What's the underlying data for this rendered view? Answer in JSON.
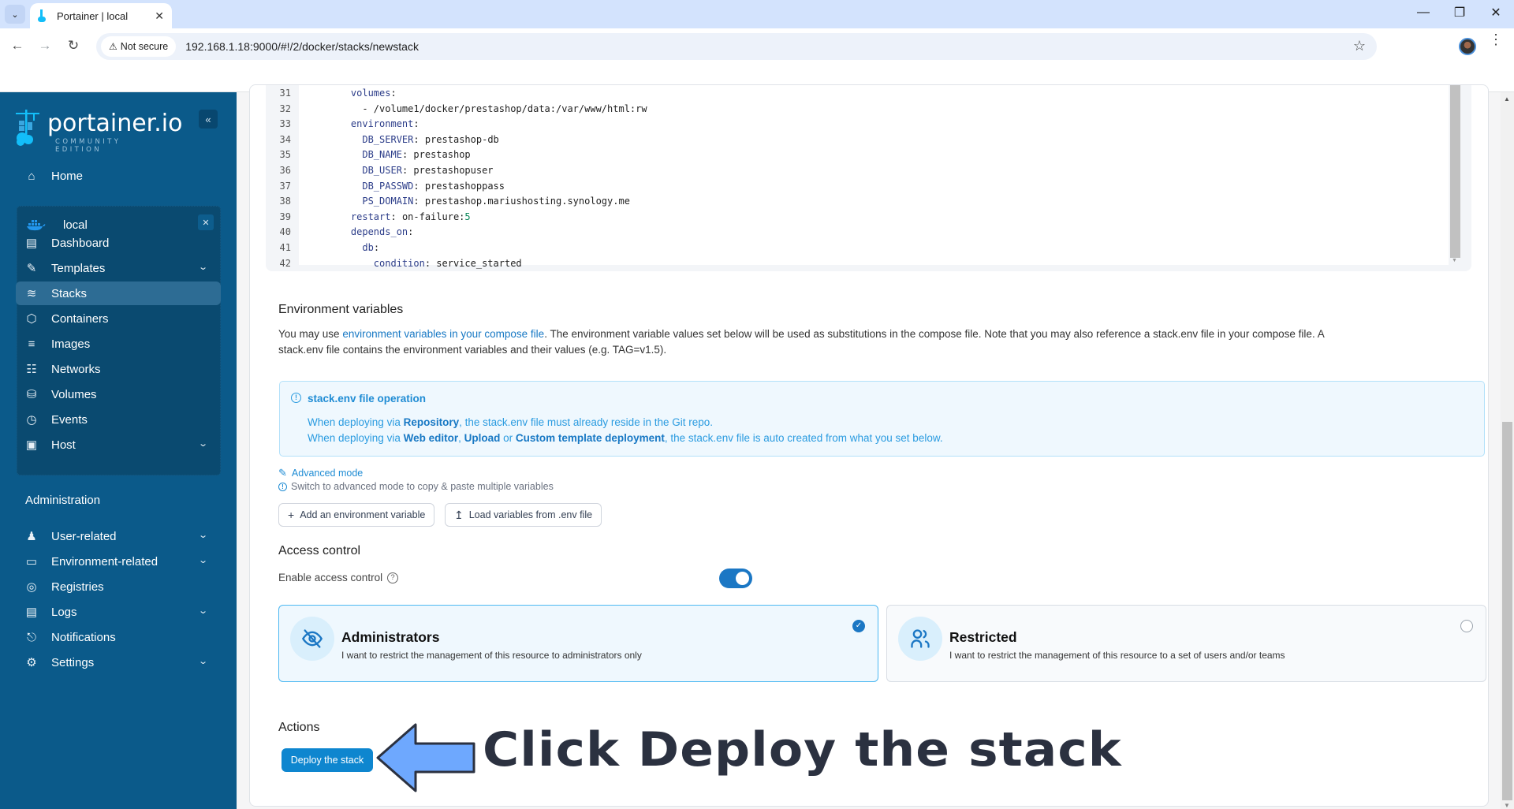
{
  "browser": {
    "tab_title": "Portainer | local",
    "security_label": "Not secure",
    "url": "192.168.1.18:9000/#!/2/docker/stacks/newstack"
  },
  "sidebar": {
    "logo_text": "portainer.io",
    "logo_subtitle": "COMMUNITY EDITION",
    "home_label": "Home",
    "environment": {
      "name": "local",
      "icon": "docker-whale-icon"
    },
    "env_items": [
      {
        "label": "Dashboard",
        "icon": "dashboard-icon",
        "expandable": false,
        "active": false
      },
      {
        "label": "Templates",
        "icon": "edit-icon",
        "expandable": true,
        "active": false
      },
      {
        "label": "Stacks",
        "icon": "layers-icon",
        "expandable": false,
        "active": true
      },
      {
        "label": "Containers",
        "icon": "box-icon",
        "expandable": false,
        "active": false
      },
      {
        "label": "Images",
        "icon": "list-icon",
        "expandable": false,
        "active": false
      },
      {
        "label": "Networks",
        "icon": "network-icon",
        "expandable": false,
        "active": false
      },
      {
        "label": "Volumes",
        "icon": "database-icon",
        "expandable": false,
        "active": false
      },
      {
        "label": "Events",
        "icon": "clock-icon",
        "expandable": false,
        "active": false
      },
      {
        "label": "Host",
        "icon": "host-icon",
        "expandable": true,
        "active": false
      }
    ],
    "admin_title": "Administration",
    "admin_items": [
      {
        "label": "User-related",
        "icon": "users-icon",
        "expandable": true
      },
      {
        "label": "Environment-related",
        "icon": "drive-icon",
        "expandable": true
      },
      {
        "label": "Registries",
        "icon": "radio-icon",
        "expandable": false
      },
      {
        "label": "Logs",
        "icon": "file-icon",
        "expandable": true
      },
      {
        "label": "Notifications",
        "icon": "bell-icon",
        "expandable": false
      },
      {
        "label": "Settings",
        "icon": "gear-icon",
        "expandable": true
      }
    ]
  },
  "editor": {
    "lines": [
      {
        "n": "31",
        "indent": "    ",
        "key": "volumes",
        "sep": ":",
        "val": ""
      },
      {
        "n": "32",
        "indent": "      ",
        "key": "",
        "sep": "",
        "val": "- /volume1/docker/prestashop/data:/var/www/html:rw"
      },
      {
        "n": "33",
        "indent": "    ",
        "key": "environment",
        "sep": ":",
        "val": ""
      },
      {
        "n": "34",
        "indent": "      ",
        "key": "DB_SERVER",
        "sep": ": ",
        "val": "prestashop-db"
      },
      {
        "n": "35",
        "indent": "      ",
        "key": "DB_NAME",
        "sep": ": ",
        "val": "prestashop"
      },
      {
        "n": "36",
        "indent": "      ",
        "key": "DB_USER",
        "sep": ": ",
        "val": "prestashopuser"
      },
      {
        "n": "37",
        "indent": "      ",
        "key": "DB_PASSWD",
        "sep": ": ",
        "val": "prestashoppass"
      },
      {
        "n": "38",
        "indent": "      ",
        "key": "PS_DOMAIN",
        "sep": ": ",
        "val": "prestashop.mariushosting.synology.me"
      },
      {
        "n": "39",
        "indent": "    ",
        "key": "restart",
        "sep": ": ",
        "val": "on-failure:",
        "num": "5"
      },
      {
        "n": "40",
        "indent": "    ",
        "key": "depends_on",
        "sep": ":",
        "val": ""
      },
      {
        "n": "41",
        "indent": "      ",
        "key": "db",
        "sep": ":",
        "val": ""
      },
      {
        "n": "42",
        "indent": "        ",
        "key": "condition",
        "sep": ": ",
        "val": "service_started"
      }
    ]
  },
  "env_vars": {
    "title": "Environment variables",
    "intro_prefix": "You may use ",
    "intro_link": "environment variables in your compose file",
    "intro_suffix": ". The environment variable values set below will be used as substitutions in the compose file. Note that you may also reference a stack.env file in your compose file. A",
    "intro_line2": "stack.env file contains the environment variables and their values (e.g. TAG=v1.5).",
    "info": {
      "title": "stack.env file operation",
      "line1_a": "When deploying via ",
      "line1_b": "Repository",
      "line1_c": ", the stack.env file must already reside in the Git repo.",
      "line2_a": "When deploying via ",
      "line2_b": "Web editor",
      "line2_c": ", ",
      "line2_d": "Upload",
      "line2_e": " or ",
      "line2_f": "Custom template deployment",
      "line2_g": ", the stack.env file is auto created from what you set below."
    },
    "advanced_mode": "Advanced mode",
    "hint": "Switch to advanced mode to copy & paste multiple variables",
    "add_button": "Add an environment variable",
    "load_button": "Load variables from .env file"
  },
  "access_control": {
    "title": "Access control",
    "toggle_label": "Enable access control",
    "enabled": true,
    "options": [
      {
        "title": "Administrators",
        "desc": "I want to restrict the management of this resource to administrators only",
        "selected": true
      },
      {
        "title": "Restricted",
        "desc": "I want to restrict the management of this resource to a set of users and/or teams",
        "selected": false
      }
    ]
  },
  "actions": {
    "title": "Actions",
    "deploy_button": "Deploy the stack"
  },
  "annotation": {
    "text": "Click Deploy the stack",
    "arrow_color": "#6ea8fe"
  }
}
